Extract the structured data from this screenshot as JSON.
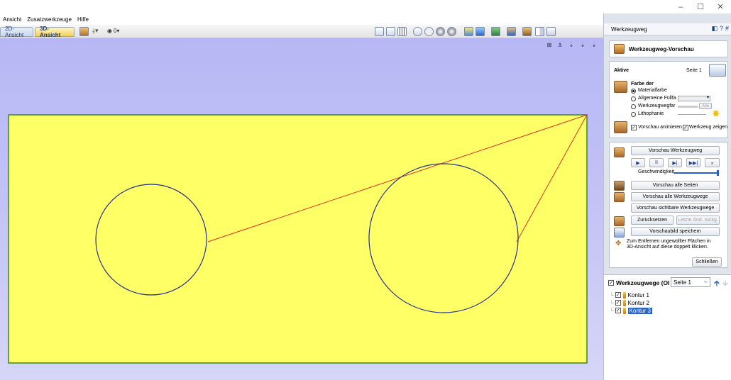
{
  "window": {
    "controls": [
      "–",
      "☐",
      "✕"
    ]
  },
  "menu": [
    "Ansicht",
    "Zusatzwerkzeuge",
    "Hilfe"
  ],
  "view_tabs": {
    "tab_2d": "2D-Ansicht",
    "tab_3d": "3D-Ansicht",
    "active": "3D-Ansicht"
  },
  "toolbar": {
    "layer_label": "0▾"
  },
  "colors": {
    "material": "#ffff66",
    "material_edge": "#3b8a1c",
    "toolpath_red": "#e0302a",
    "toolpath_blue": "#25308c",
    "viewport_bg": "#bcbcf5",
    "accent": "#1d3f8a"
  },
  "panel": {
    "header_title": "Werkzeugweg",
    "header_icons": [
      "?",
      "#"
    ],
    "preview_title": "Werkzeugweg-Vorschau",
    "aktive": {
      "label": "Aktive",
      "page": "Seite 1",
      "farbe_label": "Farbe der",
      "options": [
        "Materialfarbe",
        "Allgemeine Füllfa",
        "Werkzeugwegfar",
        "Lithophanie"
      ],
      "selected": "Materialfarbe",
      "alle_button": "Alle",
      "animate_label": "Vorschau animieren",
      "animate_checked": true,
      "show_tool_label": "Werkzeug zeigen",
      "show_tool_checked": true
    },
    "playback": {
      "preview_button": "Vorschau Werkzeugweg",
      "controls": [
        "▶",
        "II",
        "▶|",
        "▶▶|",
        "⌅"
      ],
      "speed_label": "Geschwindigkeit",
      "speed_level": 0.98
    },
    "actions": {
      "all_pages": "Vorschau alle Seiten",
      "all_toolpaths": "Vorschau alle Werkzeugwege",
      "visible_toolpaths": "Vorschau sichtbare Werkzeugwege",
      "reset": "Zurücksetzen",
      "undo_last": "Letzte Änd. rückg.",
      "save_image": "Vorschaubild speichern",
      "hint": "Zum Entfernen ungewollter Flächen in 3D-Ansicht auf diese doppelt klicken.",
      "close": "Schließen"
    },
    "toolpaths": {
      "title": "Werkzeugwege (Ol",
      "page_select": "Seite 1",
      "items": [
        {
          "label": "Kontur 1",
          "checked": true,
          "selected": false
        },
        {
          "label": "Kontur 2",
          "checked": true,
          "selected": false
        },
        {
          "label": "Kontur 3",
          "checked": true,
          "selected": true
        }
      ]
    }
  }
}
